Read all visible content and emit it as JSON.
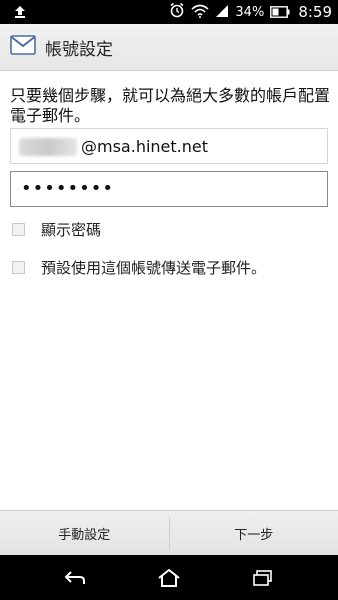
{
  "status_bar": {
    "battery_percent": "34%",
    "time": "8:59"
  },
  "header": {
    "title": "帳號設定"
  },
  "form": {
    "instructions": "只要幾個步驟，就可以為絕大多數的帳戶配置電子郵件。",
    "email_value": "@msa.hinet.net",
    "password_value": "••••••••",
    "show_password_label": "顯示密碼",
    "default_account_label": "預設使用這個帳號傳送電子郵件。"
  },
  "buttons": {
    "manual_setup": "手動設定",
    "next": "下一步"
  },
  "colors": {
    "status_bar": "#000000",
    "action_bar": "#eeeeee",
    "bottom_bar": "#e8e8e8"
  }
}
